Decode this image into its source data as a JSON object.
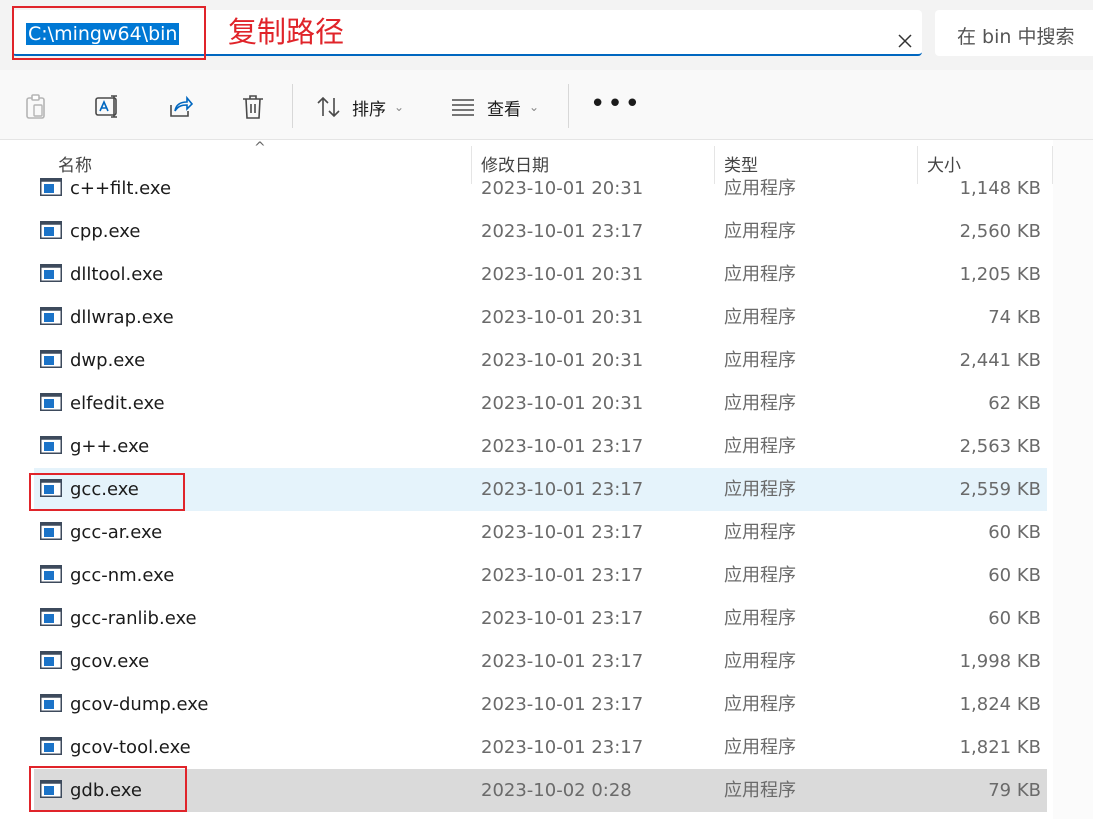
{
  "address": {
    "path": "C:\\mingw64\\bin"
  },
  "annotation": {
    "copy_path": "复制路径"
  },
  "search": {
    "placeholder": "在 bin 中搜索"
  },
  "toolbar": {
    "sort_label": "排序",
    "view_label": "查看",
    "more_label": "•••"
  },
  "columns": {
    "name": "名称",
    "date": "修改日期",
    "type": "类型",
    "size": "大小"
  },
  "files": [
    {
      "name": "c++filt.exe",
      "date": "2023-10-01 20:31",
      "type": "应用程序",
      "size": "1,148 KB"
    },
    {
      "name": "cpp.exe",
      "date": "2023-10-01 23:17",
      "type": "应用程序",
      "size": "2,560 KB"
    },
    {
      "name": "dlltool.exe",
      "date": "2023-10-01 20:31",
      "type": "应用程序",
      "size": "1,205 KB"
    },
    {
      "name": "dllwrap.exe",
      "date": "2023-10-01 20:31",
      "type": "应用程序",
      "size": "74 KB"
    },
    {
      "name": "dwp.exe",
      "date": "2023-10-01 20:31",
      "type": "应用程序",
      "size": "2,441 KB"
    },
    {
      "name": "elfedit.exe",
      "date": "2023-10-01 20:31",
      "type": "应用程序",
      "size": "62 KB"
    },
    {
      "name": "g++.exe",
      "date": "2023-10-01 23:17",
      "type": "应用程序",
      "size": "2,563 KB"
    },
    {
      "name": "gcc.exe",
      "date": "2023-10-01 23:17",
      "type": "应用程序",
      "size": "2,559 KB",
      "state": "selected"
    },
    {
      "name": "gcc-ar.exe",
      "date": "2023-10-01 23:17",
      "type": "应用程序",
      "size": "60 KB"
    },
    {
      "name": "gcc-nm.exe",
      "date": "2023-10-01 23:17",
      "type": "应用程序",
      "size": "60 KB"
    },
    {
      "name": "gcc-ranlib.exe",
      "date": "2023-10-01 23:17",
      "type": "应用程序",
      "size": "60 KB"
    },
    {
      "name": "gcov.exe",
      "date": "2023-10-01 23:17",
      "type": "应用程序",
      "size": "1,998 KB"
    },
    {
      "name": "gcov-dump.exe",
      "date": "2023-10-01 23:17",
      "type": "应用程序",
      "size": "1,824 KB"
    },
    {
      "name": "gcov-tool.exe",
      "date": "2023-10-01 23:17",
      "type": "应用程序",
      "size": "1,821 KB"
    },
    {
      "name": "gdb.exe",
      "date": "2023-10-02 0:28",
      "type": "应用程序",
      "size": "79 KB",
      "state": "hover"
    }
  ],
  "colors": {
    "accent": "#0078d4",
    "annotation_red": "#e0242a",
    "selected_row": "#e5f3fb",
    "hover_row": "#dadada"
  }
}
